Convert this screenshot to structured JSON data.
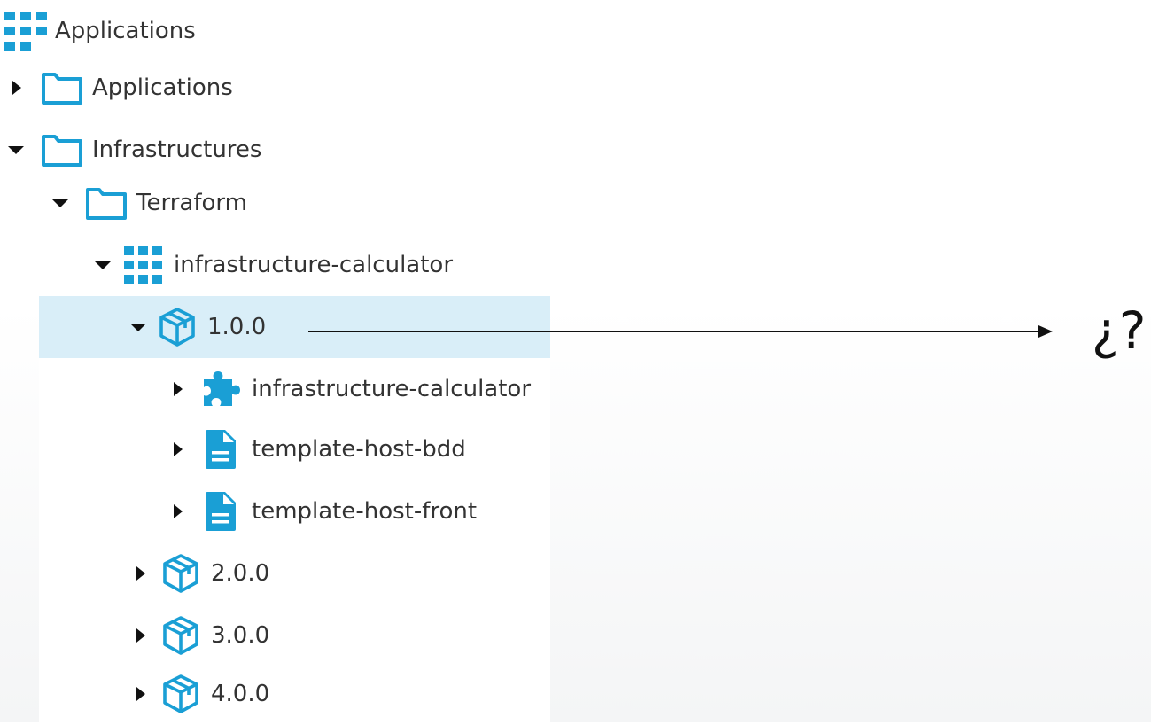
{
  "tree": {
    "root": {
      "label": "Applications",
      "icon": "grid-icon"
    },
    "items": [
      {
        "label": "Applications",
        "icon": "folder-icon",
        "expanded": false
      },
      {
        "label": "Infrastructures",
        "icon": "folder-icon",
        "expanded": true
      },
      {
        "label": "Terraform",
        "icon": "folder-icon",
        "expanded": true
      },
      {
        "label": "infrastructure-calculator",
        "icon": "grid-icon",
        "expanded": true
      },
      {
        "label": "1.0.0",
        "icon": "package-icon",
        "expanded": true,
        "selected": true
      },
      {
        "label": "infrastructure-calculator",
        "icon": "puzzle-icon",
        "expanded": false
      },
      {
        "label": "template-host-bdd",
        "icon": "document-icon",
        "expanded": false
      },
      {
        "label": "template-host-front",
        "icon": "document-icon",
        "expanded": false
      },
      {
        "label": "2.0.0",
        "icon": "package-icon",
        "expanded": false
      },
      {
        "label": "3.0.0",
        "icon": "package-icon",
        "expanded": false
      },
      {
        "label": "4.0.0",
        "icon": "package-icon",
        "expanded": false
      }
    ]
  },
  "annotation": {
    "text": "¿?"
  },
  "colors": {
    "accent": "#1a9fd5",
    "selected_background": "#d9eef8",
    "text": "#333333",
    "arrow": "#111111"
  }
}
